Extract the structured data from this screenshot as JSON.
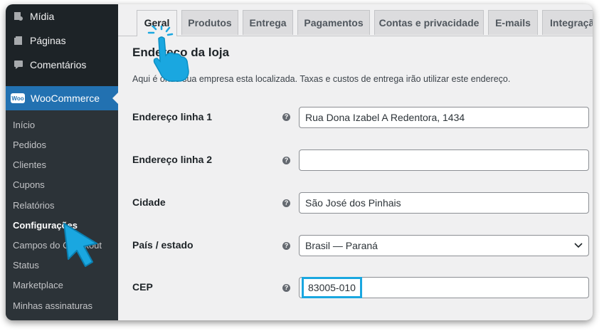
{
  "sidebar": {
    "items": [
      {
        "label": "Mídia",
        "icon": "media-icon"
      },
      {
        "label": "Páginas",
        "icon": "pages-icon"
      },
      {
        "label": "Comentários",
        "icon": "comments-icon"
      }
    ],
    "woocommerce": {
      "label": "WooCommerce",
      "icon_text": "Woo"
    },
    "submenu": [
      {
        "label": "Início",
        "active": false
      },
      {
        "label": "Pedidos",
        "active": false
      },
      {
        "label": "Clientes",
        "active": false
      },
      {
        "label": "Cupons",
        "active": false
      },
      {
        "label": "Relatórios",
        "active": false
      },
      {
        "label": "Configurações",
        "active": true
      },
      {
        "label": "Campos do Checkout",
        "active": false
      },
      {
        "label": "Status",
        "active": false
      },
      {
        "label": "Marketplace",
        "active": false
      },
      {
        "label": "Minhas assinaturas",
        "active": false
      }
    ]
  },
  "tabs": [
    {
      "label": "Geral",
      "active": true
    },
    {
      "label": "Produtos",
      "active": false
    },
    {
      "label": "Entrega",
      "active": false
    },
    {
      "label": "Pagamentos",
      "active": false
    },
    {
      "label": "Contas e privacidade",
      "active": false
    },
    {
      "label": "E-mails",
      "active": false
    },
    {
      "label": "Integração",
      "active": false
    }
  ],
  "section": {
    "title": "Endereço da loja",
    "description": "Aqui é onde sua empresa esta localizada. Taxas e custos de entrega irão utilizar este endereço."
  },
  "fields": {
    "address1": {
      "label": "Endereço linha 1",
      "value": "Rua Dona Izabel A Redentora, 1434"
    },
    "address2": {
      "label": "Endereço linha 2",
      "value": ""
    },
    "city": {
      "label": "Cidade",
      "value": "São José dos Pinhais"
    },
    "country": {
      "label": "País / estado",
      "value": "Brasil — Paraná"
    },
    "postcode": {
      "label": "CEP",
      "value": "83005-010"
    }
  },
  "help_glyph": "?",
  "colors": {
    "accent": "#2271b1",
    "highlight": "#1aa7e0",
    "sidebar": "#1d2327"
  }
}
